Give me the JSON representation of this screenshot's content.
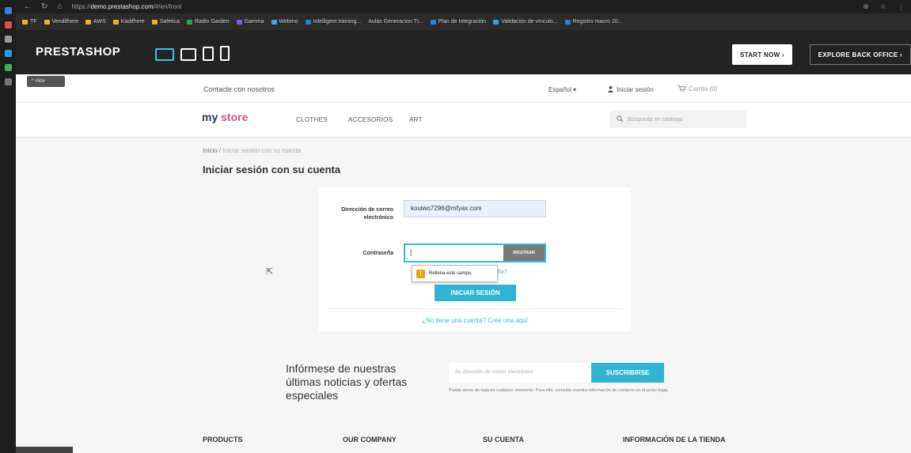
{
  "browser": {
    "url": "https://demo.prestashop.com/#/en/front",
    "url_host": "demo.prestashop.com",
    "bookmarks": [
      "TF",
      "Vendifhere",
      "AWS",
      "Kadifhere",
      "Safetica",
      "Radio Garden",
      "Gamma",
      "Webmo",
      "Intelligent training...",
      "Aulas Generacion TI...",
      "Plan de Integración",
      "Validación de vínculo...",
      "Registro macro 20..."
    ]
  },
  "ps_bar": {
    "logo": "PRESTASHOP",
    "start_now": "START NOW ›",
    "explore": "EXPLORE BACK OFFICE ›"
  },
  "hide_tab": "^ Hide",
  "store": {
    "contact": "Contacte con nosotros",
    "language": "Español ▾",
    "login": "Iniciar sesión",
    "cart": "Carrito (0)",
    "logo_main": "my ",
    "logo_accent": "store",
    "categories": [
      "CLOTHES",
      "ACCESORIOS",
      "ART"
    ],
    "search_placeholder": "Búsqueda en catálogo"
  },
  "breadcrumb": {
    "home": "Inicio",
    "sep": "/",
    "current": "Iniciar sesión con su cuenta"
  },
  "page_title": "Iniciar sesión con su cuenta",
  "login_form": {
    "email_label": "Dirección de correo electrónico",
    "email_value": "kouiwo7296@mfyax.com",
    "password_label": "Contraseña",
    "password_value": "|",
    "show_button": "MOSTRAR",
    "forgot_fragment": "eña?",
    "tooltip": "Rellena este campo.",
    "submit": "INICIAR SESIÓN",
    "create_account": "¿No tiene una cuenta? Cree una aquí"
  },
  "newsletter": {
    "title": "Infórmese de nuestras últimas noticias y ofertas especiales",
    "input_placeholder": "Su dirección de correo electrónico",
    "button": "SUSCRIBIRSE",
    "note": "Puede darse de baja en cualquier momento. Para ello, consulte nuestra información de contacto en el aviso legal."
  },
  "footer": {
    "columns": [
      "PRODUCTS",
      "OUR COMPANY",
      "SU CUENTA",
      "INFORMACIÓN DE LA TIENDA"
    ]
  },
  "colors": {
    "accent": "#2fb5d2",
    "ps_dark": "#232323",
    "warning": "#f0a30a"
  }
}
